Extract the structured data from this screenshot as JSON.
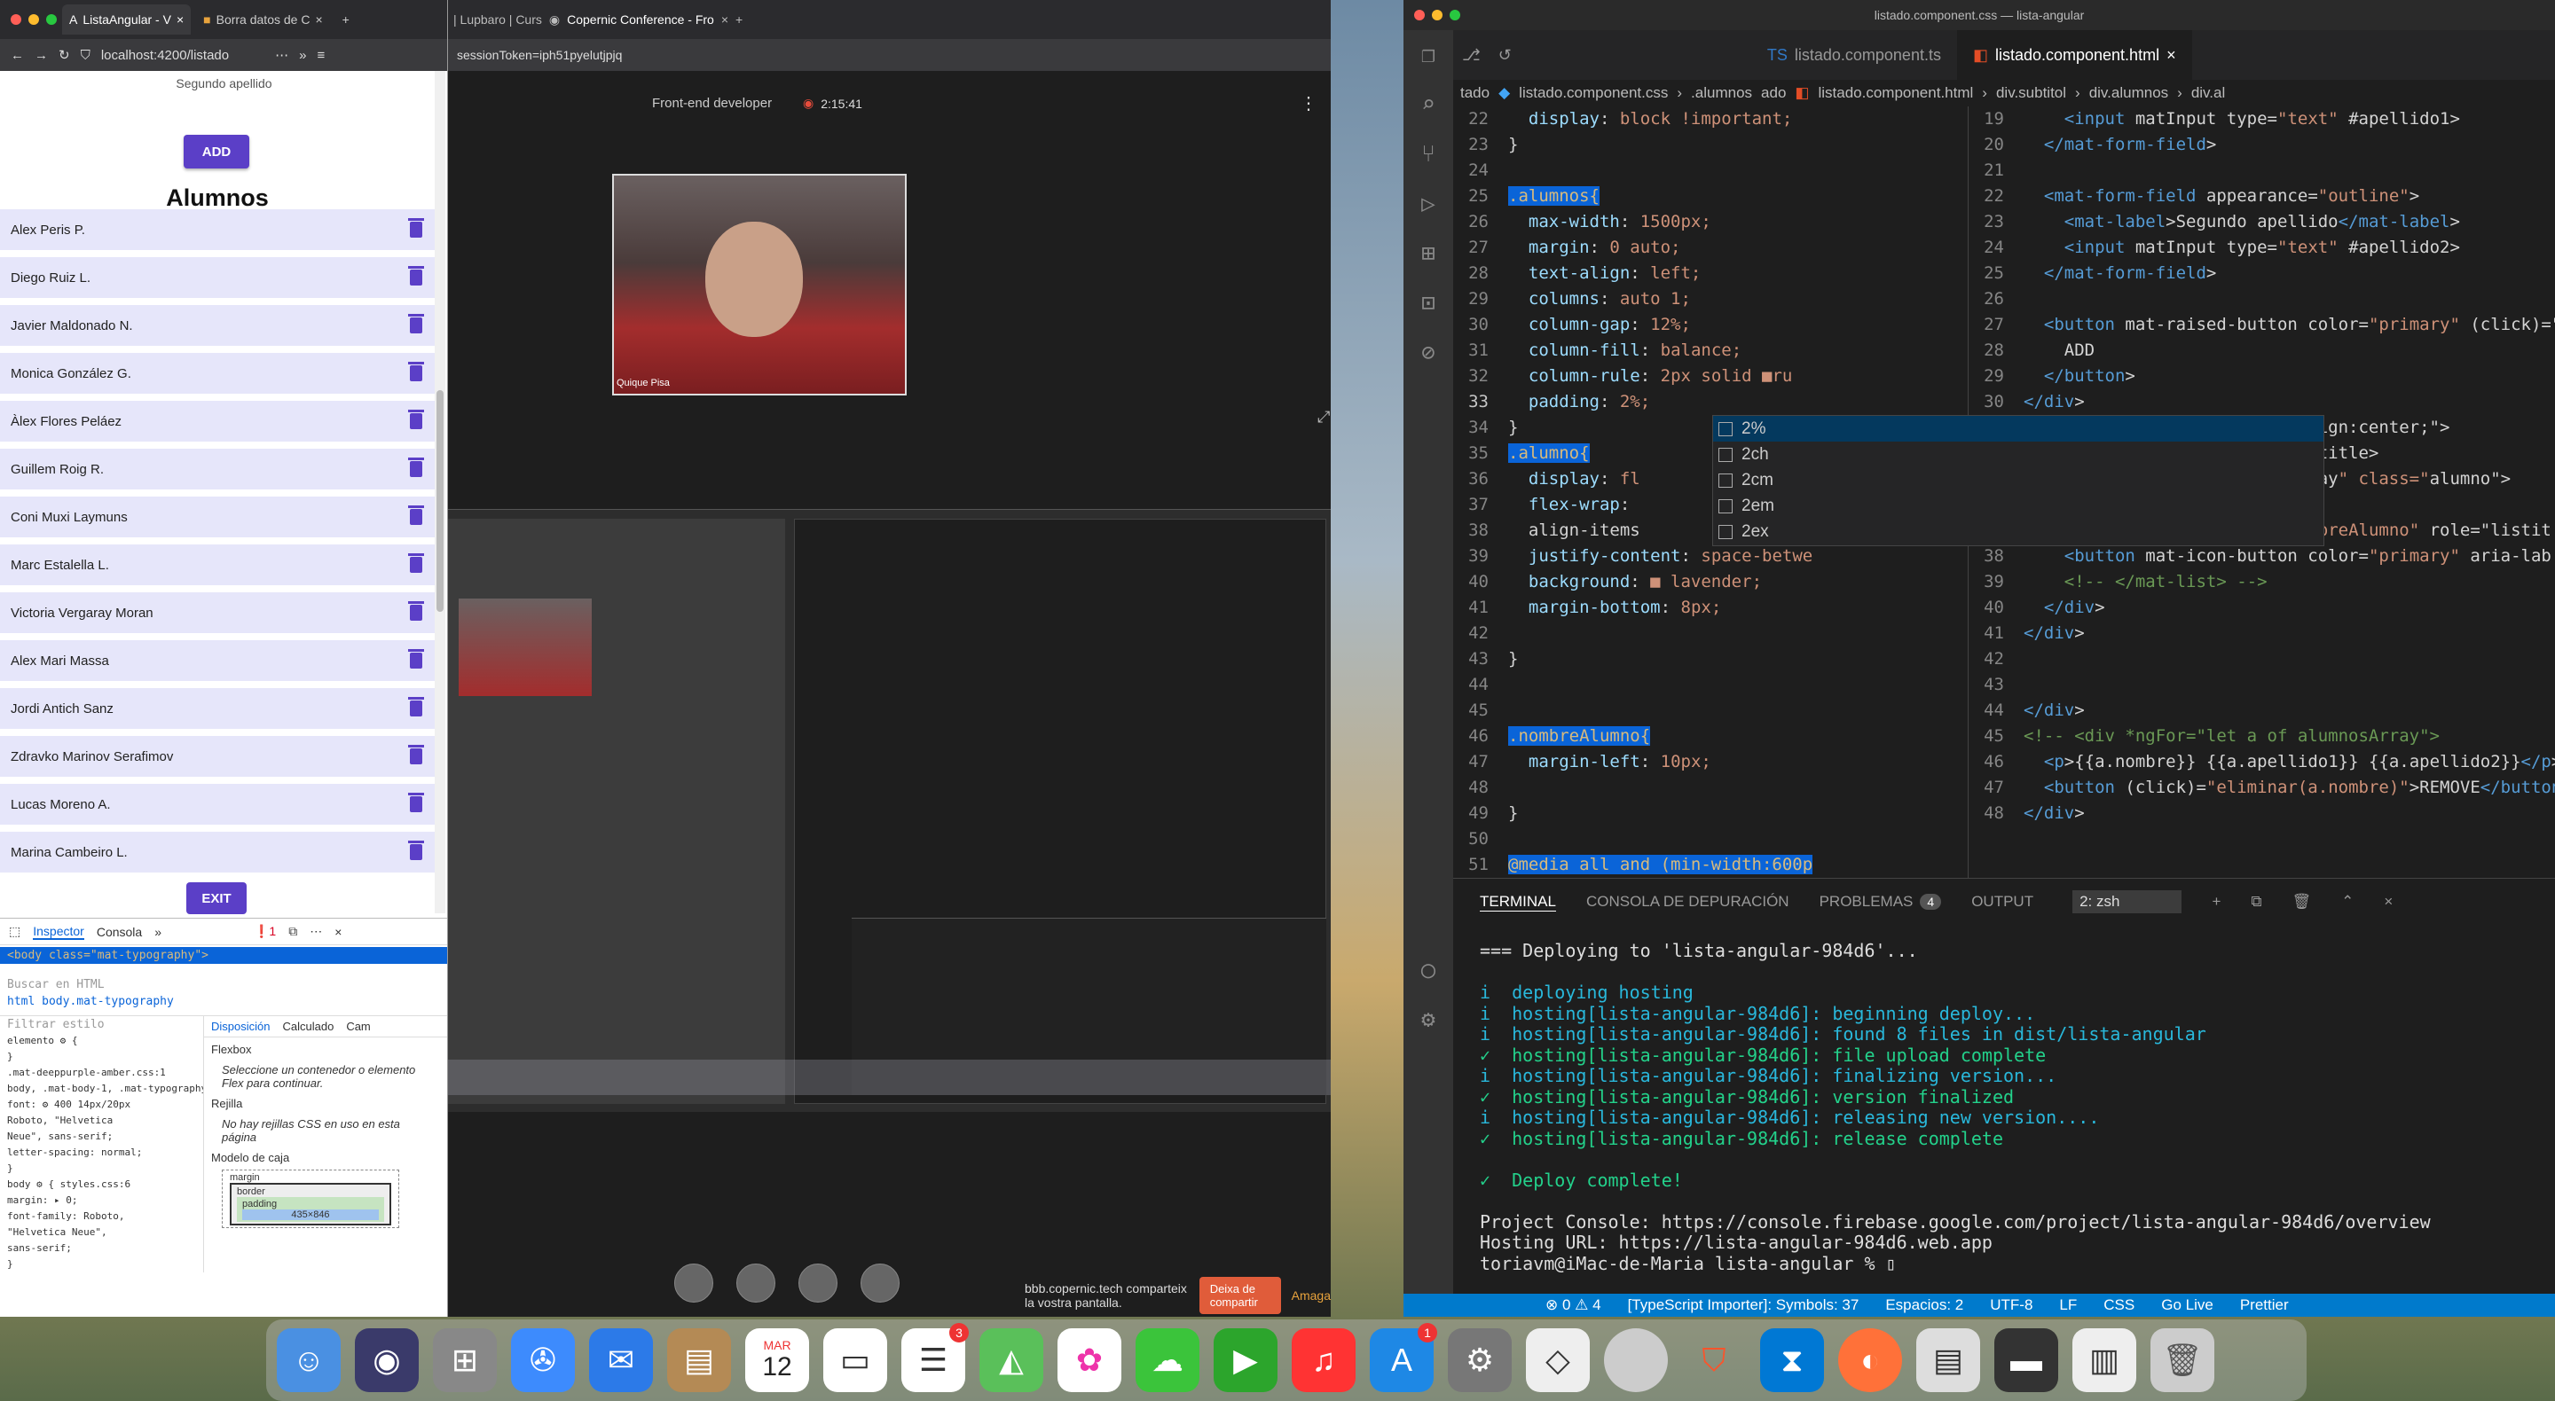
{
  "browser": {
    "tabs": [
      {
        "title": "ListaAngular - V"
      },
      {
        "title": "Borra datos de C"
      }
    ],
    "url": "localhost:4200/listado",
    "page": {
      "segundo_apellido_label": "Segundo apellido",
      "add_label": "ADD",
      "title": "Alumnos",
      "students": [
        "Alex Peris P.",
        "Diego Ruiz L.",
        "Javier Maldonado N.",
        "Monica González G.",
        "Àlex Flores Peláez",
        "Guillem Roig R.",
        "Coni Muxi Laymuns",
        "Marc Estalella L.",
        "Victoria Vergaray Moran",
        "Alex Mari Massa",
        "Jordi Antich Sanz",
        "Zdravko Marinov Serafimov",
        "Lucas Moreno A.",
        "Marina Cambeiro L."
      ],
      "exit_label": "EXIT"
    },
    "devtools": {
      "tabs": [
        "Inspector",
        "Consola"
      ],
      "selected_node": "<body class=\"mat-typography\">",
      "search_placeholder": "Buscar en HTML",
      "breadcrumb": "html  body.mat-typography",
      "filter_placeholder": "Filtrar estilo",
      "side_tabs": [
        "Disposición",
        "Calculado",
        "Cam"
      ],
      "flexbox_title": "Flexbox",
      "flexbox_msg": "Seleccione un contenedor o elemento Flex para continuar.",
      "rejilla_title": "Rejilla",
      "rejilla_msg": "No hay rejillas CSS en uso en esta página",
      "box_title": "Modelo de caja",
      "box_margin": "margin",
      "box_border": "border",
      "box_padding": "padding",
      "box_size": "435×846",
      "rules": [
        "elemento ⚙ {",
        "}",
        ".mat-deeppurple-amber.css:1",
        "body, .mat-body-1, .mat-typography",
        "  font: ⚙ 400 14px/20px",
        "  Roboto, \"Helvetica",
        "  Neue\", sans-serif;",
        "  letter-spacing: normal;",
        "}",
        "body ⚙ {        styles.css:6",
        "  margin: ▸ 0;",
        "  font-family: Roboto,",
        "  \"Helvetica Neue\",",
        "  sans-serif;",
        "}"
      ]
    }
  },
  "conference": {
    "tabs": [
      "| Lupbaro | Curs",
      "Copernic Conference - Fro"
    ],
    "url": "sessionToken=iph51pyelutjpjq",
    "role": "Front-end developer",
    "timer": "2:15:41",
    "speaker_name": "Quique Pisa",
    "share_msg": "bbb.copernic.tech comparteix la vostra pantalla.",
    "stop_label": "Deixa de compartir",
    "hide_label": "Amaga"
  },
  "vscode": {
    "title": "listado.component.css — lista-angular",
    "tabs": [
      {
        "label": "listado.component.ts",
        "active": false
      },
      {
        "label": "listado.component.html",
        "active": true
      }
    ],
    "breadcrumb_left": [
      "tado",
      "listado.component.css",
      ".alumnos",
      "ado"
    ],
    "breadcrumb_right": [
      "listado.component.html",
      "div.subtitol",
      "div.alumnos",
      "div.al"
    ],
    "css_lines": [
      {
        "n": "22",
        "t": "  display: block !important;"
      },
      {
        "n": "23",
        "t": "}"
      },
      {
        "n": "24",
        "t": ""
      },
      {
        "n": "25",
        "t": ".alumnos{"
      },
      {
        "n": "26",
        "t": "  max-width: 1500px;"
      },
      {
        "n": "27",
        "t": "  margin: 0 auto;"
      },
      {
        "n": "28",
        "t": "  text-align: left;"
      },
      {
        "n": "29",
        "t": "  columns: auto 1;"
      },
      {
        "n": "30",
        "t": "  column-gap: 12%;"
      },
      {
        "n": "31",
        "t": "  column-fill: balance;"
      },
      {
        "n": "32",
        "t": "  column-rule: 2px solid ■ru"
      },
      {
        "n": "33",
        "t": "  padding: 2%;"
      },
      {
        "n": "34",
        "t": "}"
      },
      {
        "n": "35",
        "t": ".alumno{"
      },
      {
        "n": "36",
        "t": "  display: fl"
      },
      {
        "n": "37",
        "t": "  flex-wrap: "
      },
      {
        "n": "38",
        "t": "  align-items "
      },
      {
        "n": "39",
        "t": "  justify-content: space-betwe"
      },
      {
        "n": "40",
        "t": "  background: ■ lavender;"
      },
      {
        "n": "41",
        "t": "  margin-bottom: 8px;"
      },
      {
        "n": "42",
        "t": ""
      },
      {
        "n": "43",
        "t": "}"
      },
      {
        "n": "44",
        "t": ""
      },
      {
        "n": "45",
        "t": ""
      },
      {
        "n": "46",
        "t": ".nombreAlumno{"
      },
      {
        "n": "47",
        "t": "  margin-left: 10px;"
      },
      {
        "n": "48",
        "t": ""
      },
      {
        "n": "49",
        "t": "}"
      },
      {
        "n": "50",
        "t": ""
      },
      {
        "n": "51",
        "t": "@media all and (min-width:600p"
      }
    ],
    "html_lines": [
      {
        "n": "19",
        "t": "    <input matInput type=\"text\" #apellido1>"
      },
      {
        "n": "20",
        "t": "  </mat-form-field>"
      },
      {
        "n": "21",
        "t": ""
      },
      {
        "n": "22",
        "t": "  <mat-form-field appearance=\"outline\">"
      },
      {
        "n": "23",
        "t": "    <mat-label>Segundo apellido</mat-label>"
      },
      {
        "n": "24",
        "t": "    <input matInput type=\"text\" #apellido2>"
      },
      {
        "n": "25",
        "t": "  </mat-form-field>"
      },
      {
        "n": "26",
        "t": ""
      },
      {
        "n": "27",
        "t": "  <button mat-raised-button color=\"primary\" (click)=\"cre"
      },
      {
        "n": "28",
        "t": "    ADD"
      },
      {
        "n": "29",
        "t": "  </button>"
      },
      {
        "n": "30",
        "t": "</div>"
      },
      {
        "n": "",
        "t": "                           align:center;\">"
      },
      {
        "n": "",
        "t": "                           d-title>"
      },
      {
        "n": "",
        "t": ""
      },
      {
        "n": "",
        "t": "                           rray\" class=\"alumno\">"
      },
      {
        "n": "36",
        "t": "    <!-- <mat-list> -->"
      },
      {
        "n": "37",
        "t": "    <mat-list-item class=\"nombreAlumno\" role=\"listit"
      },
      {
        "n": "38",
        "t": "    <button mat-icon-button color=\"primary\" aria-lab"
      },
      {
        "n": "39",
        "t": "    <!-- </mat-list> -->"
      },
      {
        "n": "40",
        "t": "  </div>"
      },
      {
        "n": "41",
        "t": "</div>"
      },
      {
        "n": "42",
        "t": ""
      },
      {
        "n": "43",
        "t": ""
      },
      {
        "n": "44",
        "t": "</div>"
      },
      {
        "n": "45",
        "t": "<!-- <div *ngFor=\"let a of alumnosArray\">"
      },
      {
        "n": "46",
        "t": "  <p>{{a.nombre}} {{a.apellido1}} {{a.apellido2}}</p>"
      },
      {
        "n": "47",
        "t": "  <button (click)=\"eliminar(a.nombre)\">REMOVE</button>"
      },
      {
        "n": "48",
        "t": "</div>"
      }
    ],
    "autocomplete": [
      "2%",
      "2ch",
      "2cm",
      "2em",
      "2ex"
    ],
    "panel_tabs": [
      {
        "label": "TERMINAL",
        "active": true
      },
      {
        "label": "CONSOLA DE DEPURACIÓN",
        "active": false
      },
      {
        "label": "PROBLEMAS",
        "active": false,
        "badge": "4"
      },
      {
        "label": "OUTPUT",
        "active": false
      }
    ],
    "terminal_select": "2: zsh",
    "terminal": [
      {
        "c": "w",
        "t": "=== Deploying to 'lista-angular-984d6'..."
      },
      {
        "c": "w",
        "t": ""
      },
      {
        "c": "i",
        "t": "i  deploying hosting"
      },
      {
        "c": "i",
        "t": "i  hosting[lista-angular-984d6]: beginning deploy..."
      },
      {
        "c": "i",
        "t": "i  hosting[lista-angular-984d6]: found 8 files in dist/lista-angular"
      },
      {
        "c": "g",
        "t": "✓  hosting[lista-angular-984d6]: file upload complete"
      },
      {
        "c": "i",
        "t": "i  hosting[lista-angular-984d6]: finalizing version..."
      },
      {
        "c": "g",
        "t": "✓  hosting[lista-angular-984d6]: version finalized"
      },
      {
        "c": "i",
        "t": "i  hosting[lista-angular-984d6]: releasing new version...."
      },
      {
        "c": "g",
        "t": "✓  hosting[lista-angular-984d6]: release complete"
      },
      {
        "c": "w",
        "t": ""
      },
      {
        "c": "g",
        "t": "✓  Deploy complete!"
      },
      {
        "c": "w",
        "t": ""
      },
      {
        "c": "w",
        "t": "Project Console: https://console.firebase.google.com/project/lista-angular-984d6/overview"
      },
      {
        "c": "w",
        "t": "Hosting URL: https://lista-angular-984d6.web.app"
      },
      {
        "c": "w",
        "t": "toriavm@iMac-de-Maria lista-angular % ▯"
      }
    ],
    "status": [
      "⊗ 0 ⚠ 4",
      "[TypeScript Importer]: Symbols: 37",
      "Espacios: 2",
      "UTF-8",
      "LF",
      "CSS",
      "Go Live",
      "Prettier"
    ]
  },
  "dock": {
    "calendar_month": "MAR",
    "calendar_day": "12",
    "badges": [
      "3",
      "1"
    ]
  },
  "colors": {
    "accent": "#5b3fc7",
    "row_bg": "#e6e6fa",
    "vscode_status": "#007acc"
  }
}
